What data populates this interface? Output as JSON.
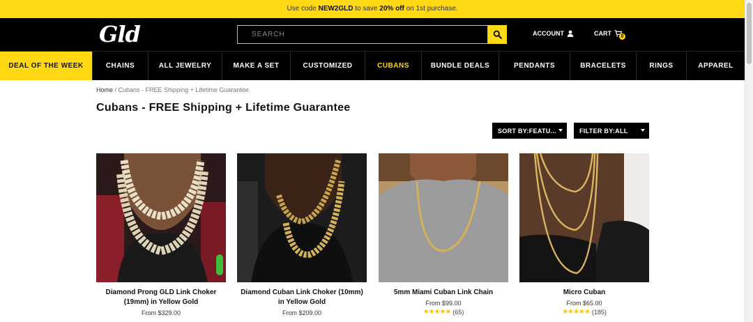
{
  "promo": {
    "pre": "Use code ",
    "code": "NEW2GLD",
    "mid": " to save ",
    "discount": "20% off",
    "post": " on 1st purchase."
  },
  "header": {
    "logo": "Gld",
    "search_placeholder": "SEARCH",
    "account_label": "ACCOUNT",
    "cart_label": "CART",
    "cart_count": "0"
  },
  "nav": {
    "items": [
      "DEAL OF THE WEEK",
      "CHAINS",
      "ALL JEWELRY",
      "MAKE A SET",
      "CUSTOMIZED",
      "CUBANS",
      "BUNDLE DEALS",
      "PENDANTS",
      "BRACELETS",
      "RINGS",
      "APPAREL"
    ]
  },
  "breadcrumb": {
    "home": "Home",
    "separator": " / ",
    "current": "Cubans - FREE Shipping + Lifetime Guarantee"
  },
  "page": {
    "title": "Cubans - FREE Shipping + Lifetime Guarantee"
  },
  "controls": {
    "sort_label": "SORT BY:FEATU...",
    "filter_label": "FILTER BY:ALL"
  },
  "products": [
    {
      "name": "Diamond Prong GLD Link Choker (19mm) in Yellow Gold",
      "price": "From $329.00"
    },
    {
      "name": "Diamond Cuban Link Choker (10mm) in Yellow Gold",
      "price": "From $209.00"
    },
    {
      "name": "5mm Miami Cuban Link Chain",
      "price": "From $99.00",
      "stars": "★★★★★",
      "reviews": "(65)"
    },
    {
      "name": "Micro Cuban",
      "price": "From $65.00",
      "stars": "★★★★★",
      "reviews": "(185)"
    }
  ],
  "colors": {
    "accent": "#ffd814",
    "dark": "#000000",
    "star": "#ffc107"
  }
}
